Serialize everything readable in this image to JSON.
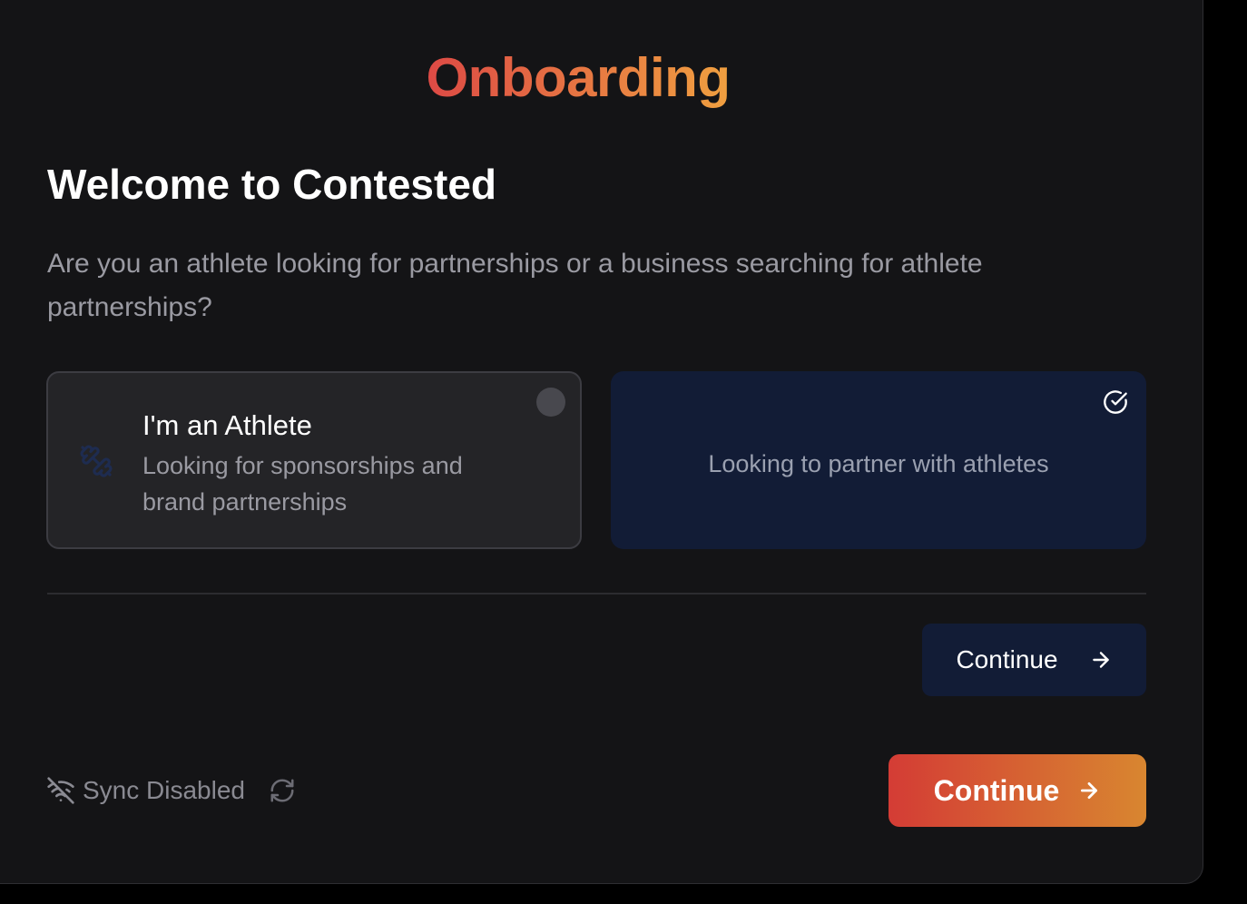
{
  "header": {
    "title": "Onboarding"
  },
  "intro": {
    "heading": "Welcome to Contested",
    "question": "Are you an athlete looking for partnerships or a business searching for athlete partnerships?"
  },
  "options": {
    "athlete": {
      "title": "I'm an Athlete",
      "description": "Looking for sponsorships and brand partnerships",
      "icon": "dumbbell-icon",
      "selected": false
    },
    "business": {
      "description": "Looking to partner with athletes",
      "icon": "check-circle-icon",
      "selected": true
    }
  },
  "actions": {
    "continue_secondary": "Continue",
    "continue_primary": "Continue"
  },
  "footer": {
    "sync_status": "Sync Disabled",
    "sync_icon": "wifi-off-icon",
    "refresh_icon": "refresh-icon"
  },
  "colors": {
    "background": "#141416",
    "accent_start": "#dd4a45",
    "accent_end": "#f0a040",
    "selected_card": "#121c36"
  }
}
